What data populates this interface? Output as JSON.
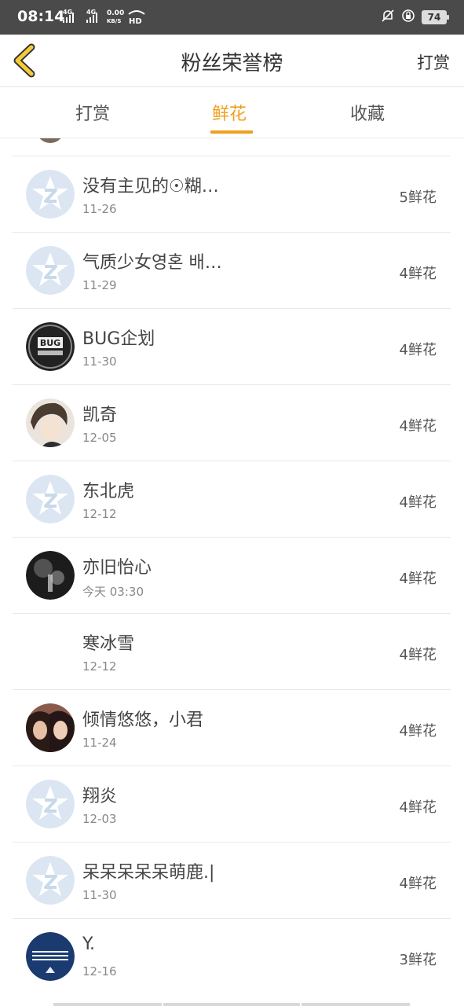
{
  "status_bar": {
    "time": "08:14",
    "net1": "4G",
    "net2": "4G",
    "speed": "0.00",
    "speed_unit": "KB/S",
    "hd": "HD",
    "battery": "74"
  },
  "header": {
    "title": "粉丝荣誉榜",
    "action_label": "打赏"
  },
  "tabs": [
    {
      "label": "打赏",
      "active": false
    },
    {
      "label": "鲜花",
      "active": true
    },
    {
      "label": "收藏",
      "active": false
    }
  ],
  "accent_color": "#f0a01e",
  "fans": [
    {
      "name": "没有主见的☉糊…",
      "date": "11-26",
      "count": "5鲜花",
      "avatar": "default-qq-avatar"
    },
    {
      "name": "气质少女영혼 배…",
      "date": "11-29",
      "count": "4鲜花",
      "avatar": "default-qq-avatar"
    },
    {
      "name": "BUG企划",
      "date": "11-30",
      "count": "4鲜花",
      "avatar": "bug-logo-avatar"
    },
    {
      "name": "凯奇",
      "date": "12-05",
      "count": "4鲜花",
      "avatar": "anime-boy-avatar"
    },
    {
      "name": "东北虎",
      "date": "12-12",
      "count": "4鲜花",
      "avatar": "default-qq-avatar"
    },
    {
      "name": "亦旧怡心",
      "date": "今天 03:30",
      "count": "4鲜花",
      "avatar": "dark-photo-avatar"
    },
    {
      "name": "寒冰雪",
      "date": "12-12",
      "count": "4鲜花",
      "avatar": "none"
    },
    {
      "name": "倾情悠悠，小君",
      "date": "11-24",
      "count": "4鲜花",
      "avatar": "girls-photo-avatar"
    },
    {
      "name": "翔炎",
      "date": "12-03",
      "count": "4鲜花",
      "avatar": "default-qq-avatar"
    },
    {
      "name": "呆呆呆呆呆萌鹿.|",
      "date": "11-30",
      "count": "4鲜花",
      "avatar": "default-qq-avatar"
    },
    {
      "name": "Y.",
      "date": "12-16",
      "count": "3鲜花",
      "avatar": "blue-stripes-avatar"
    }
  ]
}
